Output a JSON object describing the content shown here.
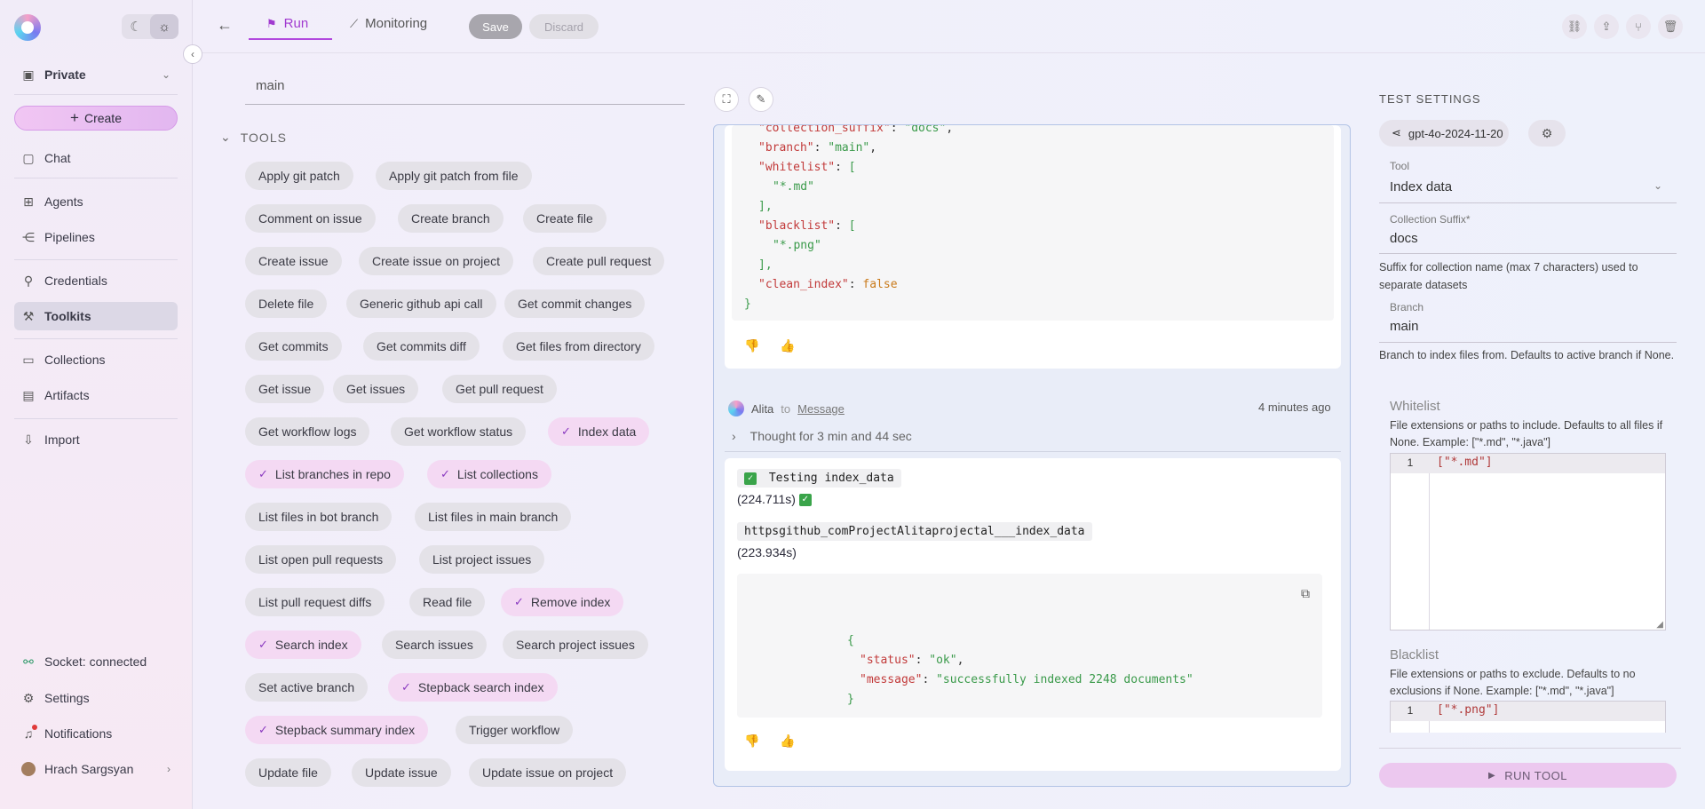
{
  "sidebar": {
    "workspace": "Private",
    "create_label": "Create",
    "items": [
      {
        "label": "Chat",
        "icon": "chat-icon",
        "glyph": "▢"
      },
      {
        "label": "Agents",
        "icon": "agents-icon",
        "glyph": "⊞"
      },
      {
        "label": "Pipelines",
        "icon": "pipelines-icon",
        "glyph": "⋲"
      },
      {
        "label": "Credentials",
        "icon": "key-icon",
        "glyph": "⚲"
      },
      {
        "label": "Toolkits",
        "icon": "wrench-icon",
        "glyph": "⚒"
      },
      {
        "label": "Collections",
        "icon": "folder-icon",
        "glyph": "▭"
      },
      {
        "label": "Artifacts",
        "icon": "artifacts-icon",
        "glyph": "▤"
      },
      {
        "label": "Import",
        "icon": "import-icon",
        "glyph": "⇩"
      }
    ],
    "socket_status": "Socket: connected",
    "settings_label": "Settings",
    "notifications_label": "Notifications",
    "user_name": "Hrach Sargsyan"
  },
  "topbar": {
    "tab_run": "Run",
    "tab_monitoring": "Monitoring",
    "save": "Save",
    "discard": "Discard"
  },
  "tools_panel": {
    "branch_value": "main",
    "tools_header": "TOOLS",
    "tools": [
      {
        "label": "Apply git patch",
        "selected": false
      },
      {
        "label": "Apply git patch from file",
        "selected": false
      },
      {
        "label": "Comment on issue",
        "selected": false
      },
      {
        "label": "Create branch",
        "selected": false
      },
      {
        "label": "Create file",
        "selected": false
      },
      {
        "label": "Create issue",
        "selected": false
      },
      {
        "label": "Create issue on project",
        "selected": false
      },
      {
        "label": "Create pull request",
        "selected": false
      },
      {
        "label": "Delete file",
        "selected": false
      },
      {
        "label": "Generic github api call",
        "selected": false
      },
      {
        "label": "Get commit changes",
        "selected": false
      },
      {
        "label": "Get commits",
        "selected": false
      },
      {
        "label": "Get commits diff",
        "selected": false
      },
      {
        "label": "Get files from directory",
        "selected": false
      },
      {
        "label": "Get issue",
        "selected": false
      },
      {
        "label": "Get issues",
        "selected": false
      },
      {
        "label": "Get pull request",
        "selected": false
      },
      {
        "label": "Get workflow logs",
        "selected": false
      },
      {
        "label": "Get workflow status",
        "selected": false
      },
      {
        "label": "Index data",
        "selected": true
      },
      {
        "label": "List branches in repo",
        "selected": true
      },
      {
        "label": "List collections",
        "selected": true
      },
      {
        "label": "List files in bot branch",
        "selected": false
      },
      {
        "label": "List files in main branch",
        "selected": false
      },
      {
        "label": "List open pull requests",
        "selected": false
      },
      {
        "label": "List project issues",
        "selected": false
      },
      {
        "label": "List pull request diffs",
        "selected": false
      },
      {
        "label": "Read file",
        "selected": false
      },
      {
        "label": "Remove index",
        "selected": true
      },
      {
        "label": "Search index",
        "selected": true
      },
      {
        "label": "Search issues",
        "selected": false
      },
      {
        "label": "Search project issues",
        "selected": false
      },
      {
        "label": "Set active branch",
        "selected": false
      },
      {
        "label": "Stepback search index",
        "selected": true
      },
      {
        "label": "Stepback summary index",
        "selected": true
      },
      {
        "label": "Trigger workflow",
        "selected": false
      },
      {
        "label": "Update file",
        "selected": false
      },
      {
        "label": "Update issue",
        "selected": false
      },
      {
        "label": "Update issue on project",
        "selected": false
      }
    ]
  },
  "chat": {
    "top_code": {
      "line0_key": "\"collection_suffix\"",
      "line0_val": "\"docs\"",
      "branch_key": "\"branch\"",
      "branch_val": "\"main\"",
      "whitelist_key": "\"whitelist\"",
      "whitelist_item": "\"*.md\"",
      "blacklist_key": "\"blacklist\"",
      "blacklist_item": "\"*.png\"",
      "clean_key": "\"clean_index\"",
      "clean_val": "false"
    },
    "sender": "Alita",
    "to_word": "to",
    "recipient": "Message",
    "time": "4 minutes ago",
    "thought": "Thought for 3 min and 44 sec",
    "test_label": "Testing index_data",
    "test_time": "(224.711s)",
    "collection_name": "httpsgithub_comProjectAlitaprojectal___index_data",
    "collection_time": "(223.934s)",
    "result": {
      "status_key": "\"status\"",
      "status_val": "\"ok\"",
      "message_key": "\"message\"",
      "message_val": "\"successfully indexed 2248 documents\""
    }
  },
  "settings": {
    "title": "TEST SETTINGS",
    "model": "gpt-4o-2024-11-20",
    "tool_label": "Tool",
    "tool_value": "Index data",
    "suffix_label": "Collection Suffix*",
    "suffix_value": "docs",
    "suffix_help": "Suffix for collection name (max 7 characters) used to separate datasets",
    "branch_label": "Branch",
    "branch_value": "main",
    "branch_help": "Branch to index files from. Defaults to active branch if None.",
    "whitelist_title": "Whitelist",
    "whitelist_help": "File extensions or paths to include. Defaults to all files if None. Example: [\"*.md\", \"*.java\"]",
    "whitelist_line_no": "1",
    "whitelist_value": "[\"*.md\"]",
    "blacklist_title": "Blacklist",
    "blacklist_help": "File extensions or paths to exclude. Defaults to no exclusions if None. Example: [\"*.md\", \"*.java\"]",
    "blacklist_line_no": "1",
    "blacklist_value": "[\"*.png\"]",
    "run_label": "RUN TOOL"
  }
}
